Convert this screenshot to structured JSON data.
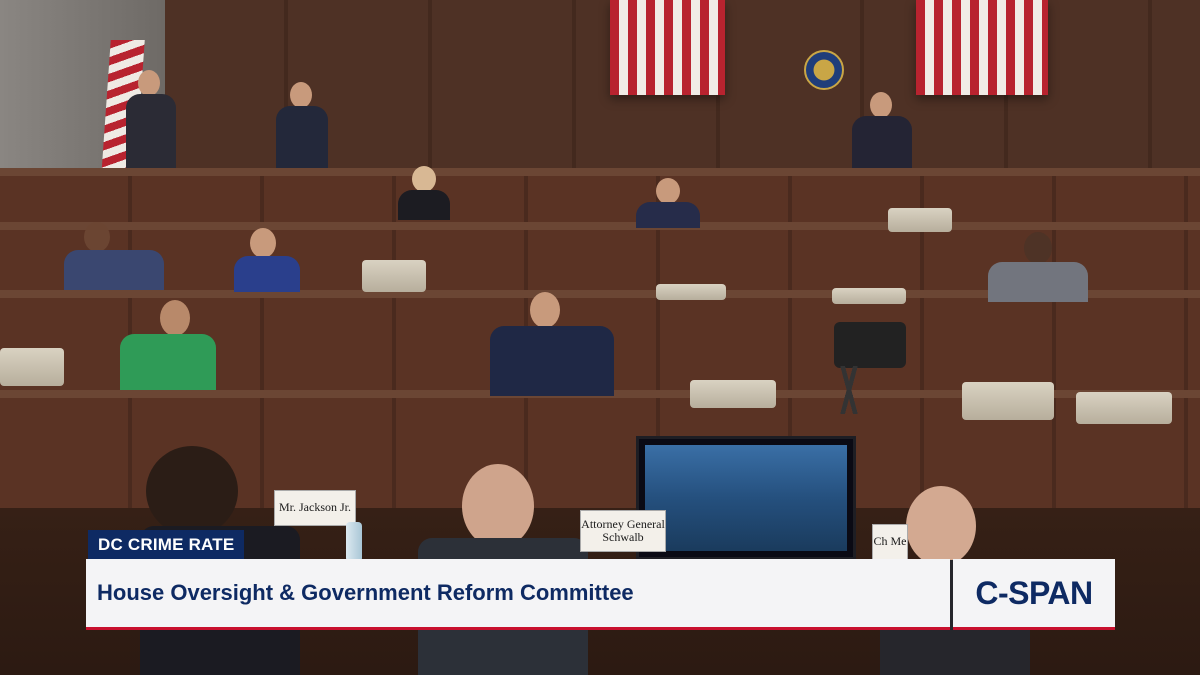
{
  "broadcast": {
    "topic_tag": "DC CRIME RATE",
    "headline": "House Oversight & Government Reform Committee",
    "network_logo": "C-SPAN"
  },
  "nameplates": {
    "front_left": "Mr. Jackson Jr.",
    "front_center": "Attorney General Schwalb",
    "front_right": "Ch Me"
  },
  "colors": {
    "tag_bg": "#0e2a63",
    "bar_text": "#0e2a63",
    "bar_accent": "#c8102e",
    "bar_bg": "#f4f4f6"
  }
}
